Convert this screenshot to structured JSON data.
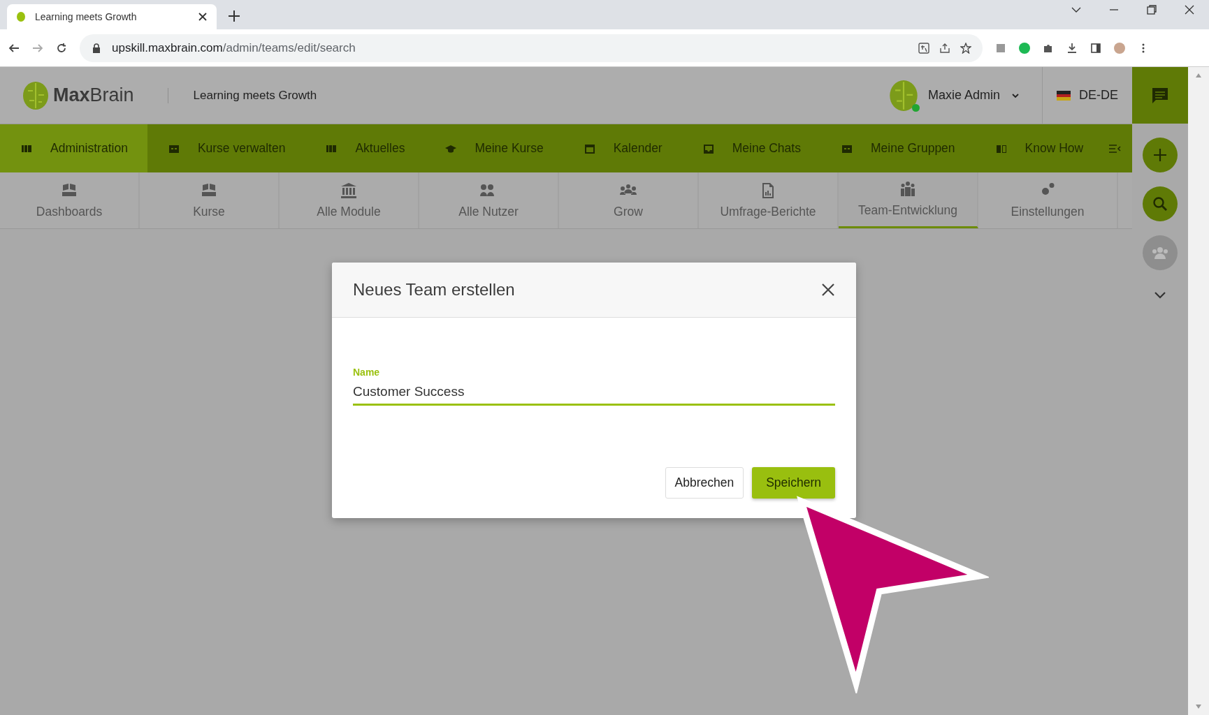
{
  "browser": {
    "tab_title": "Learning meets Growth",
    "url_host": "upskill.maxbrain.com",
    "url_path": "/admin/teams/edit/search"
  },
  "header": {
    "logo": "**Max**Brain",
    "tagline": "Learning meets Growth",
    "user_name": "Maxie Admin",
    "user_online": true,
    "language": "DE-DE"
  },
  "nav": [
    {
      "label": "Administration",
      "selected": true
    },
    {
      "label": "Kurse verwalten",
      "selected": false
    },
    {
      "label": "Aktuelles",
      "selected": false
    },
    {
      "label": "Meine Kurse",
      "selected": false
    },
    {
      "label": "Kalender",
      "selected": false
    },
    {
      "label": "Meine Chats",
      "selected": false
    },
    {
      "label": "Meine Gruppen",
      "selected": false
    },
    {
      "label": "Know How",
      "selected": false
    }
  ],
  "subnav": [
    {
      "label": "Dashboards",
      "selected": false
    },
    {
      "label": "Kurse",
      "selected": false
    },
    {
      "label": "Alle Module",
      "selected": false
    },
    {
      "label": "Alle Nutzer",
      "selected": false
    },
    {
      "label": "Grow",
      "selected": false
    },
    {
      "label": "Umfrage-Berichte",
      "selected": false
    },
    {
      "label": "Team-Entwicklung",
      "selected": true
    },
    {
      "label": "Einstellungen",
      "selected": false
    }
  ],
  "dialog": {
    "title": "Neues Team erstellen",
    "field": {
      "label": "Name",
      "value": "Customer Success"
    },
    "buttons": [
      {
        "label": "Abbrechen",
        "kind": "secondary"
      },
      {
        "label": "Speichern",
        "kind": "primary"
      }
    ]
  }
}
